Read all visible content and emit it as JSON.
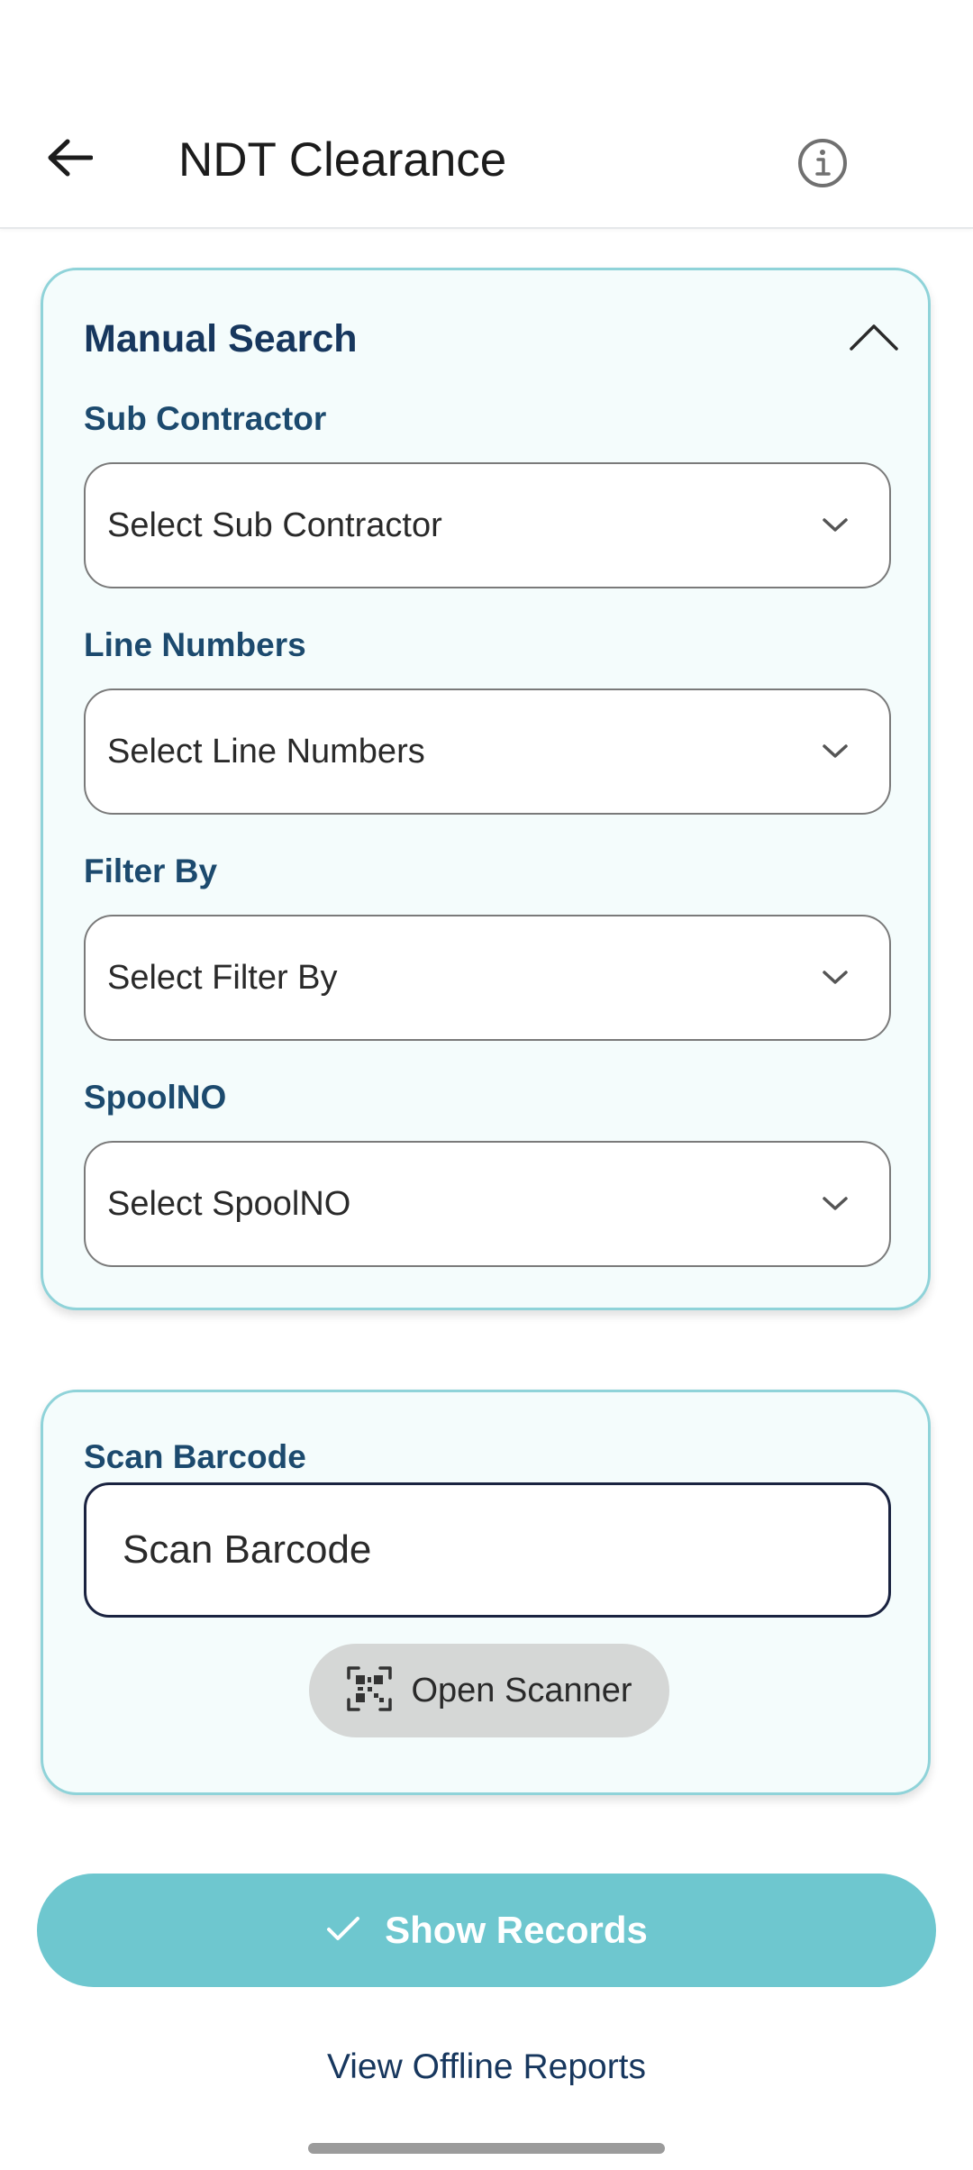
{
  "header": {
    "title": "NDT Clearance",
    "back_icon": "arrow-left-icon",
    "info_icon": "info-icon"
  },
  "manual_search": {
    "title": "Manual Search",
    "collapse_icon": "chevron-up-icon",
    "fields": [
      {
        "label": "Sub Contractor",
        "placeholder": "Select Sub Contractor"
      },
      {
        "label": "Line Numbers",
        "placeholder": "Select Line Numbers"
      },
      {
        "label": "Filter By",
        "placeholder": "Select Filter By"
      },
      {
        "label": "SpoolNO",
        "placeholder": "Select SpoolNO"
      }
    ]
  },
  "scan": {
    "label": "Scan Barcode",
    "input_value": "",
    "input_placeholder": "Scan Barcode",
    "open_scanner_label": "Open Scanner",
    "scanner_icon": "qr-code-icon"
  },
  "actions": {
    "show_records_label": "Show Records",
    "show_records_icon": "check-icon",
    "offline_reports_label": "View Offline Reports"
  },
  "colors": {
    "primary": "#6ec7cf",
    "card_border": "#8fd3d9",
    "card_background": "#f4fcfc",
    "heading": "#17375e"
  }
}
